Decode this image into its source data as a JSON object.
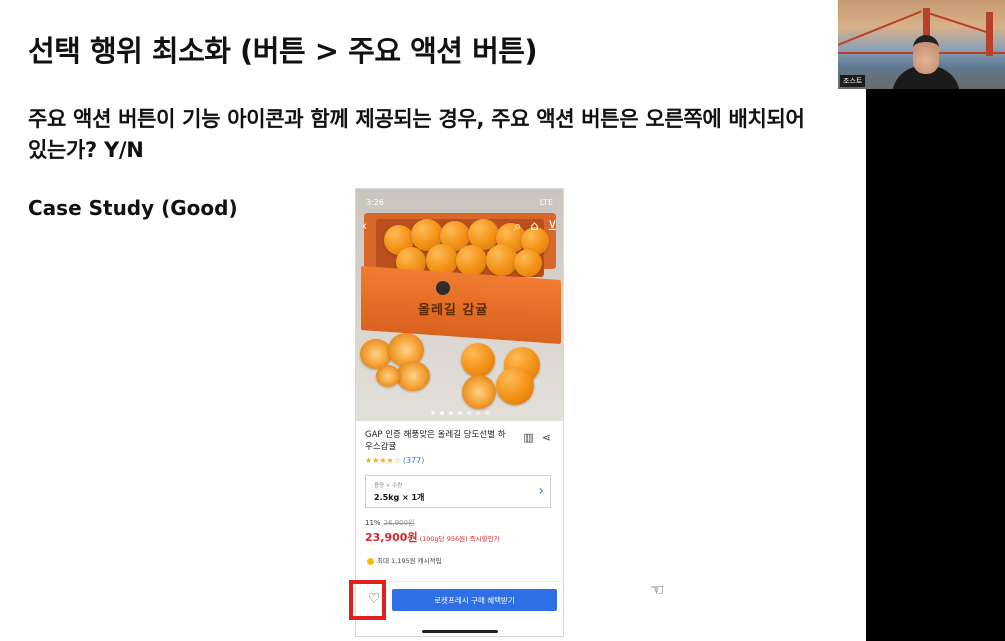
{
  "slide": {
    "title": "선택 행위 최소화 (버튼 > 주요 액션 버튼)",
    "question": "주요 액션 버튼이 기능 아이콘과 함께 제공되는 경우, 주요 액션 버튼은 오른쪽에 배치되어 있는가? Y/N",
    "case_label": "Case Study (Good)"
  },
  "phone": {
    "status_time": "3:26",
    "status_right": "LTE",
    "box_brand": "올레길 감귤",
    "product_name": "GAP 인증 해풍맞은 올레길 당도선별 하우스감귤",
    "rating_stars": "★★★★☆",
    "rating_count": "(377)",
    "option_label": "용량 × 수량",
    "option_value": "2.5kg × 1개",
    "discount_pct": "11%",
    "original_price": "26,900원",
    "price": "23,900원",
    "price_unit": "(100g당 956원) 즉시할인가",
    "cashback": "최대 1,195원 캐시적립",
    "buy_button": "로켓프레시 구매 혜택받기",
    "icons": {
      "back": "chevron-left-icon",
      "search": "search-icon",
      "home": "home-icon",
      "cart": "cart-icon",
      "compare": "compare-icon",
      "share": "share-icon",
      "heart": "heart-icon"
    }
  },
  "video": {
    "participant_name": "조스트"
  },
  "colors": {
    "highlight": "#e0201b",
    "buy_button": "#2f6fe6",
    "price": "#d7262b",
    "rating": "#f5a623"
  }
}
